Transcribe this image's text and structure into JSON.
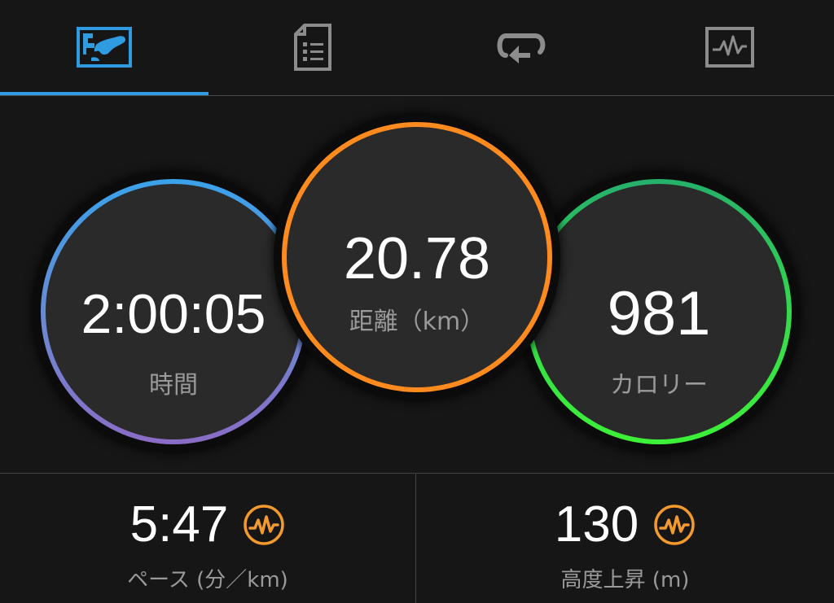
{
  "tabs": [
    {
      "icon": "map-icon",
      "active": true
    },
    {
      "icon": "details-icon",
      "active": false
    },
    {
      "icon": "laps-icon",
      "active": false
    },
    {
      "icon": "charts-icon",
      "active": false
    }
  ],
  "colors": {
    "active_tab": "#2f9be0",
    "inactive_tab": "#8c8c8c",
    "time_ring": "#3aa2ea",
    "distance_ring": "#ff8a1e",
    "calories_ring": "#3df038",
    "stat_icon": "#f29a2e"
  },
  "metrics": {
    "time": {
      "value": "2:00:05",
      "label": "時間"
    },
    "distance": {
      "value": "20.78",
      "label": "距離（km）"
    },
    "calories": {
      "value": "981",
      "label": "カロリー"
    }
  },
  "stats": {
    "pace": {
      "value": "5:47",
      "label": "ペース (分／km)",
      "icon": "pulse-chart-icon"
    },
    "elevation": {
      "value": "130",
      "label": "高度上昇 (m)",
      "icon": "pulse-chart-icon"
    }
  }
}
